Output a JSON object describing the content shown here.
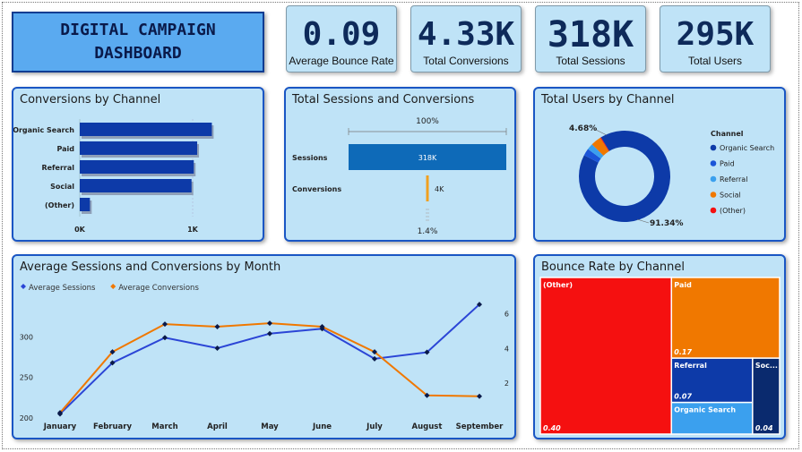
{
  "header": {
    "title": "DIGITAL CAMPAIGN\nDASHBOARD"
  },
  "kpis": [
    {
      "value": "0.09",
      "label": "Average Bounce Rate"
    },
    {
      "value": "4.33K",
      "label": "Total Conversions"
    },
    {
      "value": "318K",
      "label": "Total Sessions"
    },
    {
      "value": "295K",
      "label": "Total Users"
    }
  ],
  "colors": {
    "panel_bg": "#bfe3f7",
    "panel_border": "#1a56c4",
    "dark_blue": "#0d3aa8",
    "orange": "#f07800",
    "red": "#f51010",
    "mid_blue": "#1b55d8",
    "light_blue": "#3ba0ee",
    "navy": "#0a2a6e"
  },
  "panels": {
    "conversions_by_channel": "Conversions by Channel",
    "sessions_conversions": "Total Sessions and Conversions",
    "users_by_channel": "Total Users by Channel",
    "monthly": "Average Sessions and Conversions by Month",
    "bounce": "Bounce Rate by Channel"
  },
  "chart_data": [
    {
      "type": "bar",
      "orientation": "horizontal",
      "title": "Conversions by Channel",
      "categories": [
        "Organic Search",
        "Paid",
        "Referral",
        "Social",
        "(Other)"
      ],
      "values": [
        1170,
        1040,
        1010,
        990,
        90
      ],
      "xticks": [
        "0K",
        "1K"
      ],
      "xlim": [
        0,
        1200
      ]
    },
    {
      "type": "bar",
      "subtype": "funnel",
      "title": "Total Sessions and Conversions",
      "categories": [
        "Sessions",
        "Conversions"
      ],
      "values": [
        318000,
        4330
      ],
      "value_labels": [
        "318K",
        "4K"
      ],
      "top_label": "100%",
      "bottom_label": "1.4%"
    },
    {
      "type": "pie",
      "subtype": "donut",
      "title": "Total Users by Channel",
      "legend_title": "Channel",
      "legend_position": "right",
      "slices": [
        {
          "name": "Organic Search",
          "value": 91.34,
          "color": "#0d3aa8"
        },
        {
          "name": "Paid",
          "value": 2.5,
          "color": "#1b55d8"
        },
        {
          "name": "Referral",
          "value": 2.18,
          "color": "#3ba0ee"
        },
        {
          "name": "Social",
          "value": 3.7,
          "color": "#f07800"
        },
        {
          "name": "(Other)",
          "value": 0.28,
          "color": "#f51010"
        }
      ],
      "slice_labels": [
        "4.68%",
        "91.34%"
      ]
    },
    {
      "type": "line",
      "title": "Average Sessions and Conversions by Month",
      "legend_position": "top-left",
      "categories": [
        "January",
        "February",
        "March",
        "April",
        "May",
        "June",
        "July",
        "August",
        "September"
      ],
      "series": [
        {
          "name": "Average Sessions",
          "axis": "left",
          "color": "#2b45d6",
          "values": [
            205,
            268,
            299,
            286,
            304,
            310,
            273,
            281,
            340
          ]
        },
        {
          "name": "Average Conversions",
          "axis": "right",
          "color": "#f07800",
          "values": [
            0.3,
            3.8,
            5.4,
            5.25,
            5.45,
            5.25,
            3.8,
            1.3,
            1.25
          ]
        }
      ],
      "y_left": {
        "ticks": [
          "200",
          "250",
          "300"
        ],
        "lim": [
          200,
          350
        ]
      },
      "y_right": {
        "ticks": [
          "2",
          "4",
          "6"
        ],
        "lim": [
          0,
          7
        ]
      }
    },
    {
      "type": "treemap",
      "title": "Bounce Rate by Channel",
      "items": [
        {
          "name": "(Other)",
          "value": 0.4,
          "label": "0.40",
          "color": "#f51010"
        },
        {
          "name": "Paid",
          "value": 0.17,
          "label": "0.17",
          "color": "#f07800"
        },
        {
          "name": "Referral",
          "value": 0.07,
          "label": "0.07",
          "color": "#0d3aa8"
        },
        {
          "name": "Organic Search",
          "value": 0.05,
          "label": "",
          "color": "#3ba0ee"
        },
        {
          "name": "Soc...",
          "value": 0.04,
          "label": "0.04",
          "color": "#0a2a6e"
        }
      ]
    }
  ]
}
